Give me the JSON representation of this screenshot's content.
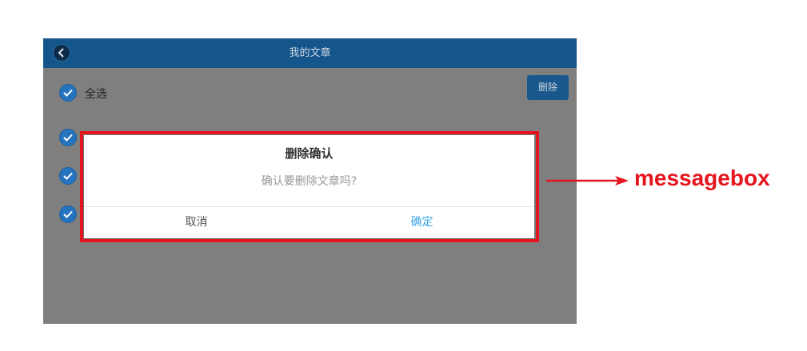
{
  "header": {
    "title": "我的文章",
    "back_icon": "back-arrow-icon"
  },
  "toolbar": {
    "select_all_label": "全选",
    "delete_label": "删除"
  },
  "list": {
    "check_icon": "check-circle-icon",
    "rows": 3
  },
  "dialog": {
    "title": "删除确认",
    "message": "确认要删除文章吗?",
    "cancel_label": "取消",
    "confirm_label": "确定"
  },
  "annotation": {
    "label": "messagebox",
    "color": "#e3141d"
  },
  "colors": {
    "header": "#14568c",
    "overlay": "#7f7f7f",
    "check": "#2674c0",
    "confirm": "#3aa6e8"
  }
}
